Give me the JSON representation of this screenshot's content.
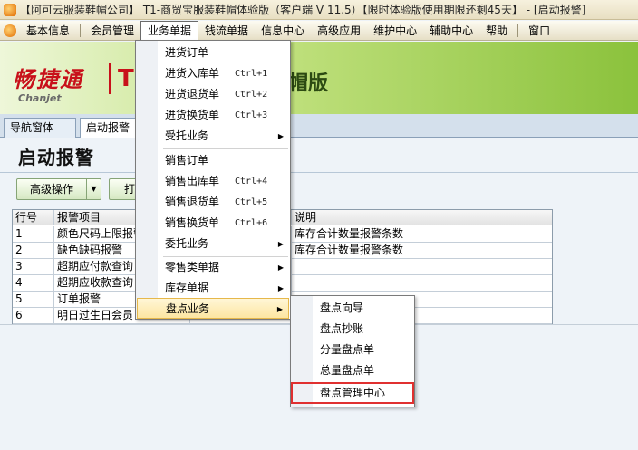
{
  "window": {
    "title": "【阿可云服装鞋帽公司】 T1-商贸宝服装鞋帽体验版（客户端 V 11.5）【限时体验版使用期限还剩45天】 - [启动报警]"
  },
  "menubar": {
    "items": [
      "基本信息",
      "会员管理",
      "业务单据",
      "钱流单据",
      "信息中心",
      "高级应用",
      "维护中心",
      "辅助中心",
      "帮助",
      "窗口"
    ]
  },
  "banner": {
    "brand_cn": "畅捷通",
    "brand_en": "Chanjet",
    "product_prefix": "T1",
    "product_suffix": "帽版"
  },
  "tabs": [
    {
      "label": "导航窗体"
    },
    {
      "label": "启动报警"
    }
  ],
  "page": {
    "title": "启动报警"
  },
  "toolbar": {
    "advanced_label": "高级操作",
    "print_label": "打"
  },
  "grid": {
    "headers": {
      "no": "行号",
      "item": "报警项目",
      "mid": "",
      "desc": "说明"
    },
    "rows": [
      {
        "no": "1",
        "item": "颜色尺码上限报警",
        "mid": "",
        "desc": "库存合计数量报警条数"
      },
      {
        "no": "2",
        "item": "缺色缺码报警",
        "mid": "",
        "desc": "库存合计数量报警条数"
      },
      {
        "no": "3",
        "item": "超期应付款查询",
        "mid": "",
        "desc": ""
      },
      {
        "no": "4",
        "item": "超期应收款查询",
        "mid": "",
        "desc": ""
      },
      {
        "no": "5",
        "item": "订单报警",
        "mid": "",
        "desc": ""
      },
      {
        "no": "6",
        "item": "明日过生日会员",
        "mid": "",
        "desc": ""
      }
    ]
  },
  "dropdown": {
    "items": [
      {
        "label": "进货订单",
        "shortcut": "",
        "submenu": false
      },
      {
        "label": "进货入库单",
        "shortcut": "Ctrl+1",
        "submenu": false
      },
      {
        "label": "进货退货单",
        "shortcut": "Ctrl+2",
        "submenu": false
      },
      {
        "label": "进货换货单",
        "shortcut": "Ctrl+3",
        "submenu": false
      },
      {
        "label": "受托业务",
        "shortcut": "",
        "submenu": true
      },
      {
        "label": "销售订单",
        "shortcut": "",
        "submenu": false
      },
      {
        "label": "销售出库单",
        "shortcut": "Ctrl+4",
        "submenu": false
      },
      {
        "label": "销售退货单",
        "shortcut": "Ctrl+5",
        "submenu": false
      },
      {
        "label": "销售换货单",
        "shortcut": "Ctrl+6",
        "submenu": false
      },
      {
        "label": "委托业务",
        "shortcut": "",
        "submenu": true
      },
      {
        "label": "零售类单据",
        "shortcut": "",
        "submenu": true
      },
      {
        "label": "库存单据",
        "shortcut": "",
        "submenu": true
      },
      {
        "label": "盘点业务",
        "shortcut": "",
        "submenu": true
      }
    ]
  },
  "submenu": {
    "items": [
      {
        "label": "盘点向导"
      },
      {
        "label": "盘点抄账"
      },
      {
        "label": "分量盘点单"
      },
      {
        "label": "总量盘点单"
      },
      {
        "label": "盘点管理中心"
      }
    ]
  }
}
